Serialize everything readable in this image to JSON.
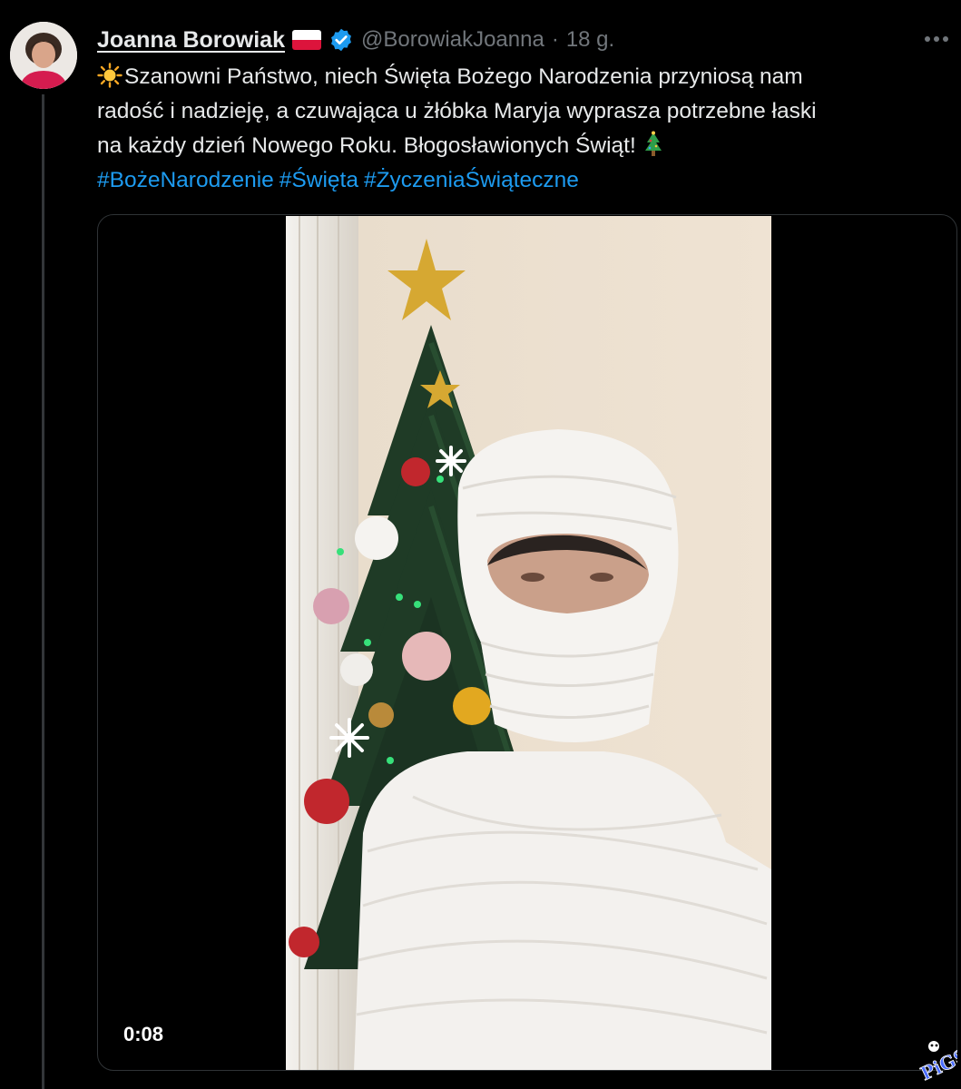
{
  "author": {
    "display_name": "Joanna Borowiak",
    "flag_icon": "poland-flag-icon",
    "verified_icon": "verified-badge-icon",
    "handle": "@BorowiakJoanna",
    "separator": "·",
    "time": "18 g."
  },
  "tweet": {
    "line1": "Szanowni Państwo, niech Święta Bożego Narodzenia przyniosą nam",
    "line2": "radość i nadzieję, a czuwająca u żłóbka Maryja wyprasza potrzebne łaski",
    "line3": "na każdy dzień Nowego Roku. Błogosławionych Świąt!",
    "hashtags": [
      "#BożeNarodzenie",
      "#Święta",
      "#ŻyczeniaŚwiąteczne"
    ]
  },
  "video": {
    "timestamp": "0:08"
  },
  "colors": {
    "background": "#000000",
    "text": "#e7e9ea",
    "secondary_text": "#71767b",
    "link": "#1d9bf0",
    "verified": "#1d9bf0"
  }
}
